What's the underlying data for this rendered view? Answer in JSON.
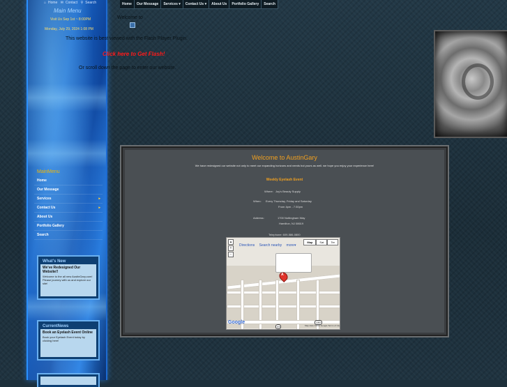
{
  "topbar": {
    "home": "Home",
    "contact": "Contact",
    "search": "Search"
  },
  "sidebar_header": {
    "title": "Main Menu",
    "line1": "Visit Us Sep 1st ~ 8:00PM",
    "line2": "Monday, July 29, 2024  1:08 PM"
  },
  "nav": {
    "items": [
      "Home",
      "Our Message",
      "Services ▾",
      "Contact Us ▾",
      "About Us",
      "Portfolio Gallery",
      "Search"
    ]
  },
  "flash": {
    "welcome": "Welcome to",
    "need_plugin": "This website is best viewed with the Flash Player Plugin.",
    "get_flash": "Click here to Get Flash!",
    "scroll": "Or scroll down the page to enter our website."
  },
  "menu": {
    "title": "MainMenu",
    "items": [
      {
        "label": "Home",
        "arrow": ""
      },
      {
        "label": "Our Message",
        "arrow": ""
      },
      {
        "label": "Services",
        "arrow": "▸"
      },
      {
        "label": "Contact Us",
        "arrow": "▸"
      },
      {
        "label": "About Us",
        "arrow": ""
      },
      {
        "label": "Portfolio Gallery",
        "arrow": ""
      },
      {
        "label": "Search",
        "arrow": ""
      }
    ]
  },
  "whats_new": {
    "header": "What's New",
    "subtitle": "We've Redesigned Our Website!!",
    "body": "Welcome to the all new AustinGary.com! Please journey with us and explore our site!"
  },
  "current_news": {
    "header": "CurrentNews",
    "subtitle": "Book an Eyelash Event Online",
    "body": "Book your Eyelash Event today by clicking here!"
  },
  "content": {
    "welcome": "Welcome to AustinGary",
    "intro": "We have redesigned our website not only to meet our expanding horizons and needs but yours as well.  we hope you enjoy your experience here!",
    "event_title": "Weekly Eyelash Event",
    "where_label": "Where:",
    "where_value": "Joy's Beauty Supply",
    "when_label": "When:",
    "when_value": "Every Thursday, Friday and Saturday",
    "time_value": "From 4pm - 7:30pm",
    "address_label": "Address:",
    "address_line1": "1700 Nottingham Way",
    "address_line2": "Hamilton, NJ 08619",
    "telephone": "Telephone: 609-586-0800"
  },
  "map": {
    "directions": "Directions",
    "search_nearby": "Search nearby",
    "more": "more▾",
    "type_map": "Map",
    "type_sat": "Sat",
    "type_ter": "Ter",
    "pin_label": "A",
    "logo": "Google",
    "copyright": "Map data ©2011 Google  Terms of Use",
    "route1": "33",
    "route2": "130"
  },
  "colors": {
    "accent": "#f0a020",
    "flash_link": "#ff1a1a",
    "menu_title": "#f5b800",
    "sidebar_blue": "#1a66c8"
  }
}
